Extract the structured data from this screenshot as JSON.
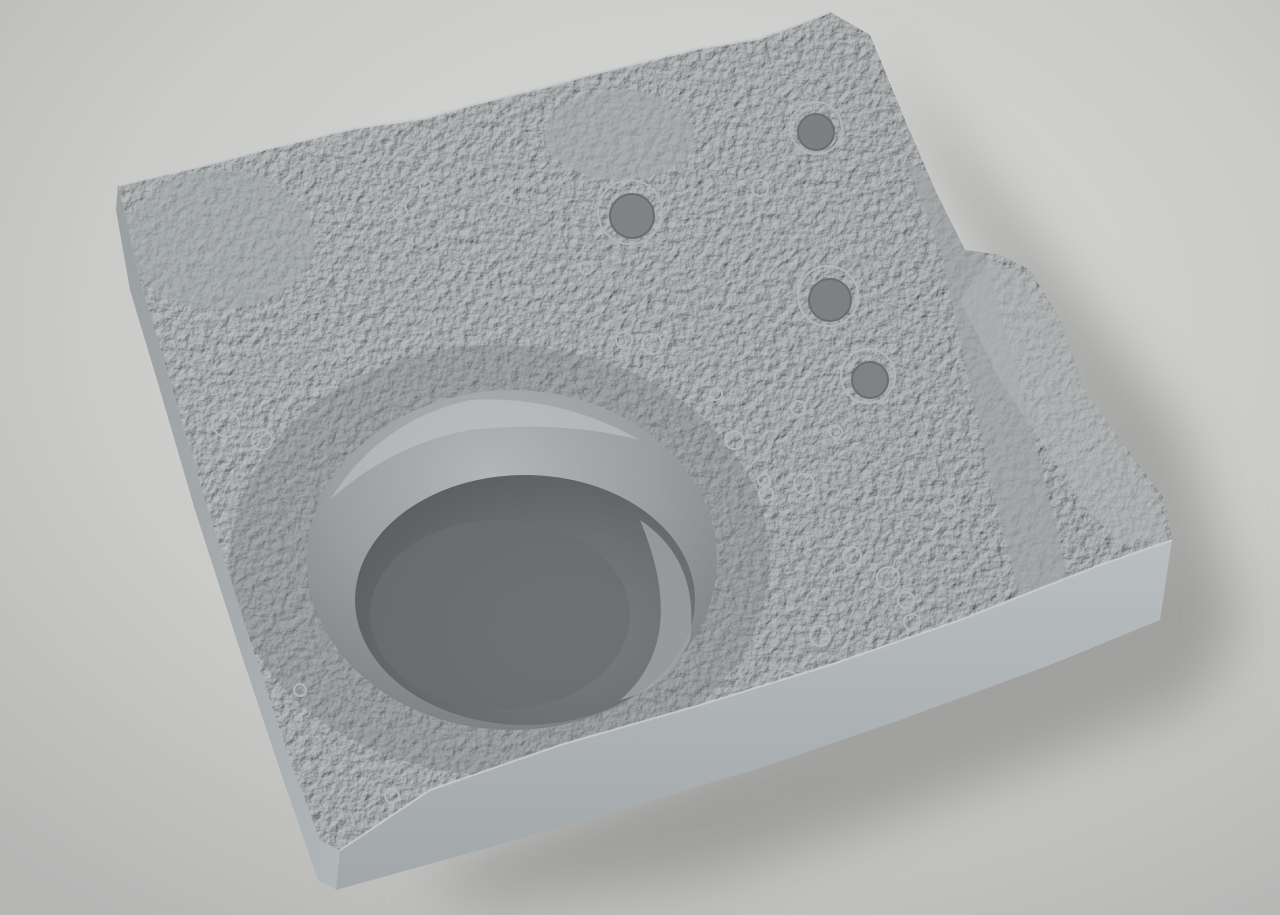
{
  "scene": {
    "subject": "relief-model",
    "colors": {
      "background": "#c9c9c8",
      "terrain_top": "#8f9394",
      "terrain_highlight": "#b4b8b9",
      "terrain_shadow": "#5d6162",
      "side_face": "#a9aeb0",
      "side_face_light": "#c3c7c8",
      "cast_shadow": "#8e8e8d"
    }
  }
}
